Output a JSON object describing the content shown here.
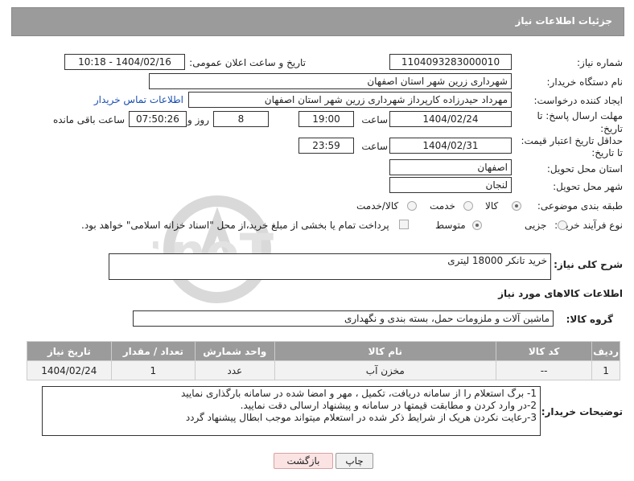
{
  "header": {
    "title": "جزئیات اطلاعات نیاز"
  },
  "form": {
    "need_number_label": "شماره نیاز:",
    "need_number": "1104093283000010",
    "announce_label": "تاریخ و ساعت اعلان عمومی:",
    "announce_value": "1404/02/16 - 10:18",
    "buyer_org_label": "نام دستگاه خریدار:",
    "buyer_org": "شهرداری زرین شهر استان اصفهان",
    "creator_label": "ایجاد کننده درخواست:",
    "creator": "مهرداد حیدرزاده کارپرداز شهرداری زرین شهر استان اصفهان",
    "contact_link": "اطلاعات تماس خریدار",
    "deadline_label_1": "مهلت ارسال پاسخ: تا",
    "deadline_label_2": "تاریخ:",
    "deadline_date": "1404/02/24",
    "time_label": "ساعت",
    "deadline_time": "19:00",
    "days_value": "8",
    "days_label": "روز و",
    "remaining_time": "07:50:26",
    "remaining_label": "ساعت باقی مانده",
    "validity_label_1": "حداقل تاریخ اعتبار قیمت:",
    "validity_label_2": "تا تاریخ:",
    "validity_date": "1404/02/31",
    "validity_time": "23:59",
    "province_label": "استان محل تحویل:",
    "province": "اصفهان",
    "city_label": "شهر محل تحویل:",
    "city": "لنجان",
    "category_label": "طبقه بندی موضوعی:",
    "category_options": [
      "کالا",
      "خدمت",
      "کالا/خدمت"
    ],
    "category_selected": "کالا",
    "process_label": "نوع فرآیند خرید :",
    "process_options": [
      "جزیی",
      "متوسط"
    ],
    "process_selected": "متوسط",
    "payment_note": "پرداخت تمام یا بخشی از مبلغ خرید،از محل \"اسناد خزانه اسلامی\" خواهد بود."
  },
  "description": {
    "label": "شرح کلی نیاز:",
    "value": "خرید تانکر 18000 لیتری"
  },
  "goods": {
    "section_title": "اطلاعات کالاهای مورد نیاز",
    "group_label": "گروه کالا:",
    "group_value": "ماشین آلات و ملزومات حمل، بسته بندی و نگهداری",
    "columns": [
      "ردیف",
      "کد کالا",
      "نام کالا",
      "واحد شمارش",
      "تعداد / مقدار",
      "تاریخ نیاز"
    ],
    "rows": [
      {
        "row": "1",
        "code": "--",
        "name": "مخزن آب",
        "unit": "عدد",
        "qty": "1",
        "date": "1404/02/24"
      }
    ]
  },
  "buyer_notes": {
    "label": "توضیحات خریدار:",
    "lines": [
      "1- برگ استعلام را از سامانه دریافت، تکمیل ، مهر و امضا شده در سامانه بارگذاری نمایید",
      "2-در وارد کردن و مطابقت قیمتها در سامانه و پیشنهاد ارسالی دقت نمایید.",
      "3-رعایت نکردن هریک از شرایط  ذکر شده در استعلام میتواند موجب ابطال پیشنهاد گردد"
    ]
  },
  "buttons": {
    "print": "چاپ",
    "back": "بازگشت"
  },
  "watermark": {
    "text": "AriaTender.neT"
  },
  "colors": {
    "header_bg": "#9b9b9b",
    "link": "#1a4fb0",
    "back_button_bg": "#fbe3e3"
  }
}
